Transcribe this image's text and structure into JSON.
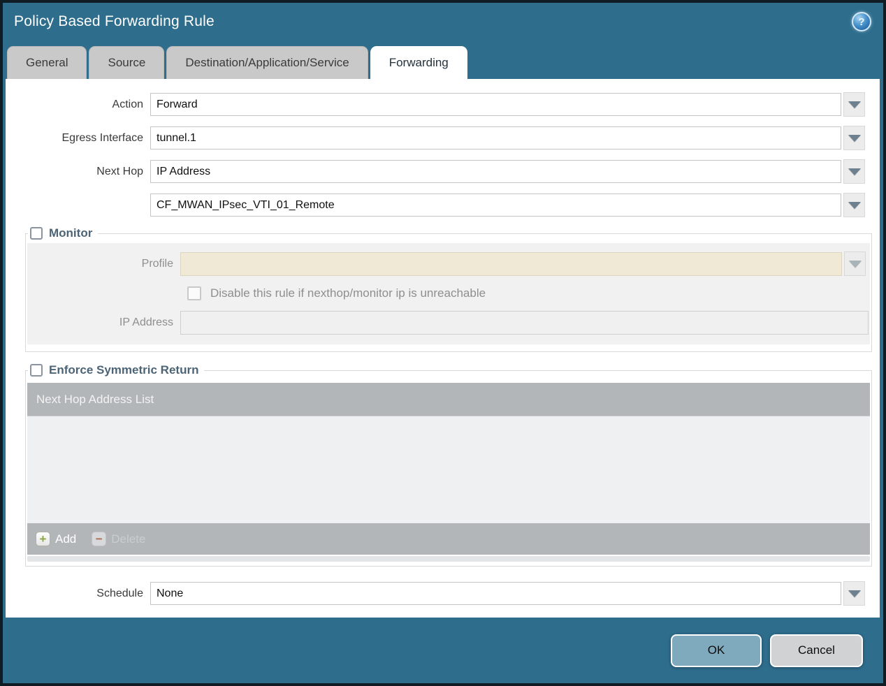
{
  "window": {
    "title": "Policy Based Forwarding Rule"
  },
  "icons": {
    "help_glyph": "?",
    "add_glyph": "+",
    "delete_glyph": "−"
  },
  "tabs": [
    {
      "label": "General",
      "active": false
    },
    {
      "label": "Source",
      "active": false
    },
    {
      "label": "Destination/Application/Service",
      "active": false
    },
    {
      "label": "Forwarding",
      "active": true
    }
  ],
  "form": {
    "action_label": "Action",
    "action_value": "Forward",
    "egress_label": "Egress Interface",
    "egress_value": "tunnel.1",
    "next_hop_label": "Next Hop",
    "next_hop_value": "IP Address",
    "next_hop_address_value": "CF_MWAN_IPsec_VTI_01_Remote",
    "schedule_label": "Schedule",
    "schedule_value": "None"
  },
  "monitor": {
    "legend": "Monitor",
    "checked": false,
    "profile_label": "Profile",
    "profile_value": "",
    "disable_checkbox_label": "Disable this rule if nexthop/monitor ip is unreachable",
    "disable_checked": false,
    "ip_address_label": "IP Address",
    "ip_address_value": ""
  },
  "enforce": {
    "legend": "Enforce Symmetric Return",
    "checked": false,
    "table_header": "Next Hop Address List",
    "rows": [],
    "add_label": "Add",
    "delete_label": "Delete",
    "delete_enabled": false
  },
  "buttons": {
    "ok": "OK",
    "cancel": "Cancel"
  },
  "colors": {
    "titlebar": "#2e6d8c",
    "frame_border": "#101c24",
    "inactive_tab": "#c9c9c9",
    "legend_text": "#4c6475",
    "table_header_bg": "#b3b6b9",
    "table_body_bg": "#eff0f1",
    "profile_field_bg": "#f0e9d6",
    "ok_button": "#7fa9bd",
    "cancel_button": "#d0d2d4",
    "add_plus": "#8aa83c",
    "delete_minus": "#b06a52"
  }
}
